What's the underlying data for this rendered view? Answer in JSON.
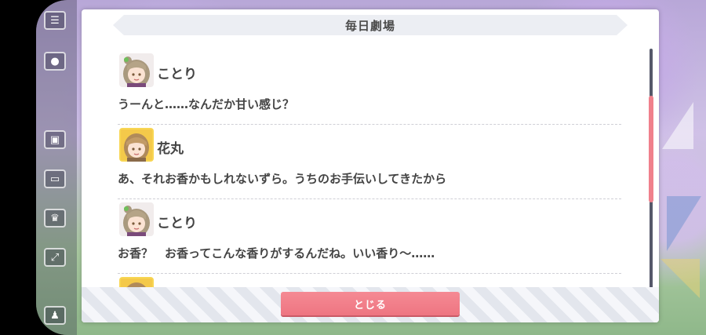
{
  "dialog": {
    "title": "毎日劇場",
    "close_label": "とじる"
  },
  "entries": [
    {
      "speaker": "ことり",
      "avatar": "kotori-portrait",
      "line": "うーんと……なんだか甘い感じ？"
    },
    {
      "speaker": "花丸",
      "avatar": "hanamaru-portrait",
      "line": "あ、それお香かもしれないずら。うちのお手伝いしてきたから"
    },
    {
      "speaker": "ことり",
      "avatar": "kotori-portrait",
      "line": "お香？　お香ってこんな香りがするんだね。いい香り～……"
    },
    {
      "speaker": "",
      "avatar": "hanamaru-portrait",
      "line": ""
    }
  ],
  "colors": {
    "accent": "#ee7581",
    "title_bg": "#eceef3",
    "text": "#444444"
  }
}
